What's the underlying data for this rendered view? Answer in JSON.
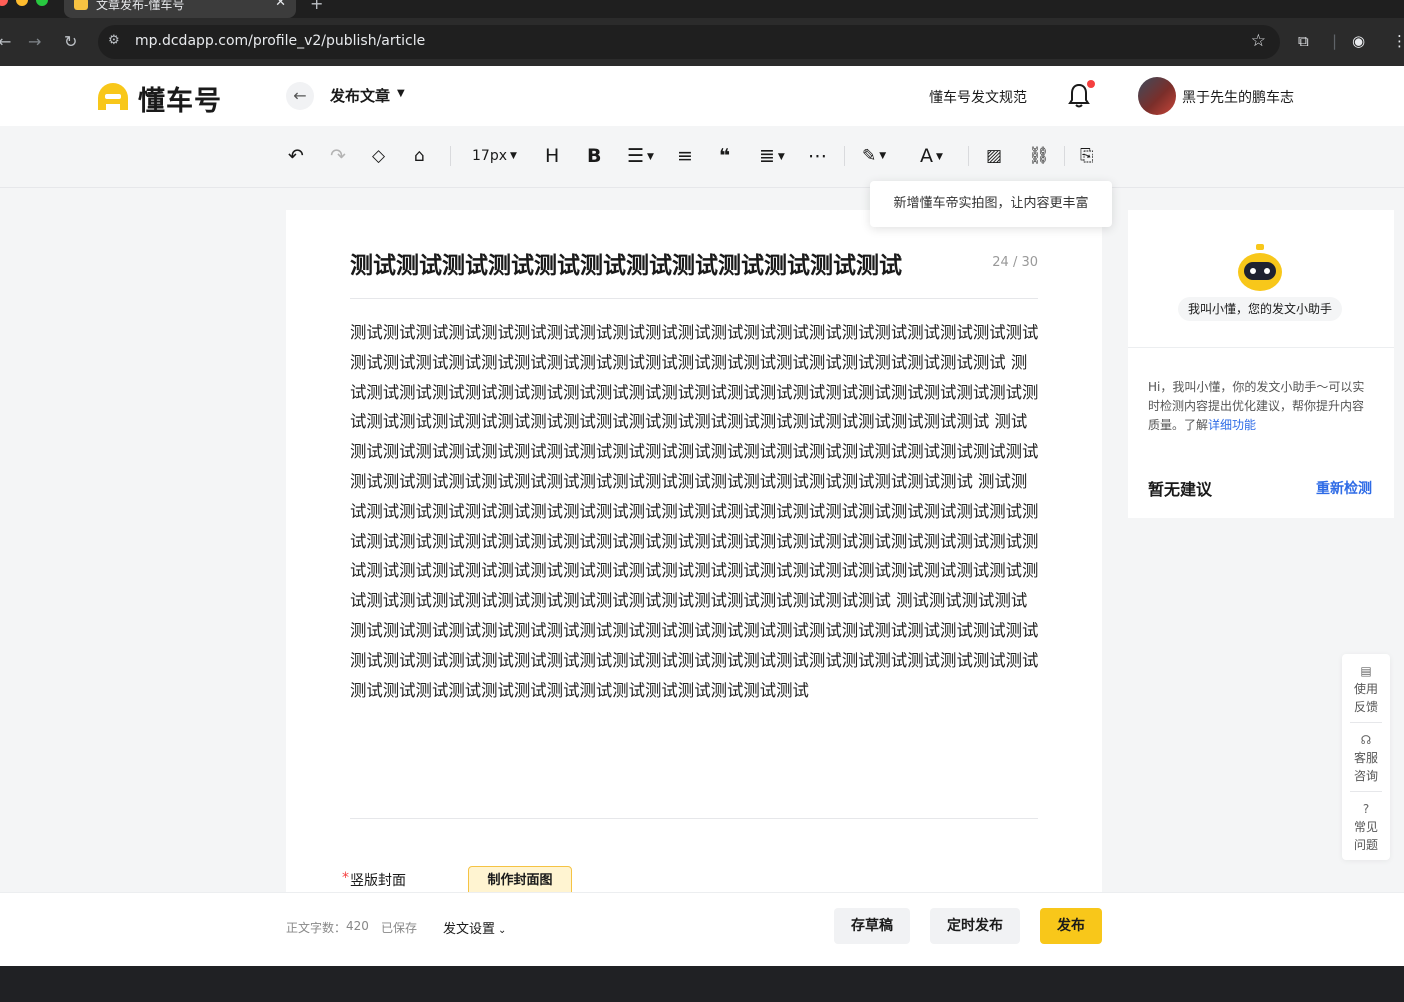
{
  "browser": {
    "tab_title": "文章发布-懂车号",
    "url": "mp.dcdapp.com/profile_v2/publish/article"
  },
  "header": {
    "logo_text": "懂车号",
    "page_title": "发布文章",
    "rules_link": "懂车号发文规范",
    "username": "黑于先生的鹏车志"
  },
  "toolbar": {
    "font_size": "17px"
  },
  "tooltip": {
    "text": "新增懂车帝实拍图，让内容更丰富"
  },
  "editor": {
    "title": "测试测试测试测试测试测试测试测试测试测试测试测试",
    "title_count": "24 / 30",
    "body": "测试测试测试测试测试测试测试测试测试测试测试测试测试测试测试测试测试测试测试测试测试测试测试测试测试测试测试测试测试测试测试测试测试测试测试测试测试测试测试测试测试 测试测试测试测试测试测试测试测试测试测试测试测试测试测试测试测试测试测试测试测试测试测试测试测试测试测试测试测试测试测试测试测试测试测试测试测试测试测试测试测试测试 测试测试测试测试测试测试测试测试测试测试测试测试测试测试测试测试测试测试测试测试测试测试测试测试测试测试测试测试测试测试测试测试测试测试测试测试测试测试测试测试测试 测试测试测试测试测试测试测试测试测试测试测试测试测试测试测试测试测试测试测试测试测试测试测试测试测试测试测试测试测试测试测试测试测试测试测试测试测试测试测试测试测试测试测试测试测试测试测试测试测试测试测试测试测试测试测试测试测试测试测试测试测试测试测试测试测试测试测试测试测试测试测试测试测试测试测试测试测试测试测试测试测试 测试测试测试测试测试测试测试测试测试测试测试测试测试测试测试测试测试测试测试测试测试测试测试测试测试测试测试测试测试测试测试测试测试测试测试测试测试测试测试测试测试测试测试测试测试测试测试测试测试测试测试测试测试测试测试测试测试测试测试测试",
    "cover_required_mark": "*",
    "cover_label": "竖版封面",
    "cover_button": "制作封面图"
  },
  "assistant": {
    "caption": "我叫小懂，您的发文小助手",
    "desc_prefix": "Hi，我叫小懂，你的发文小助手～可以实时检测内容提出优化建议，帮你提升内容质量。了解",
    "desc_link": "详细功能",
    "no_suggestion": "暂无建议",
    "recheck": "重新检测"
  },
  "float_sidebar": {
    "feedback": "使用反馈",
    "service": "客服咨询",
    "faq": "常见问题"
  },
  "footer": {
    "word_count_label": "正文字数：",
    "word_count": "420",
    "saved": "已保存",
    "settings": "发文设置",
    "draft": "存草稿",
    "schedule": "定时发布",
    "publish": "发布"
  },
  "colors": {
    "brand": "#f8c71a",
    "link": "#2e6be6",
    "required": "#f53f3f"
  }
}
